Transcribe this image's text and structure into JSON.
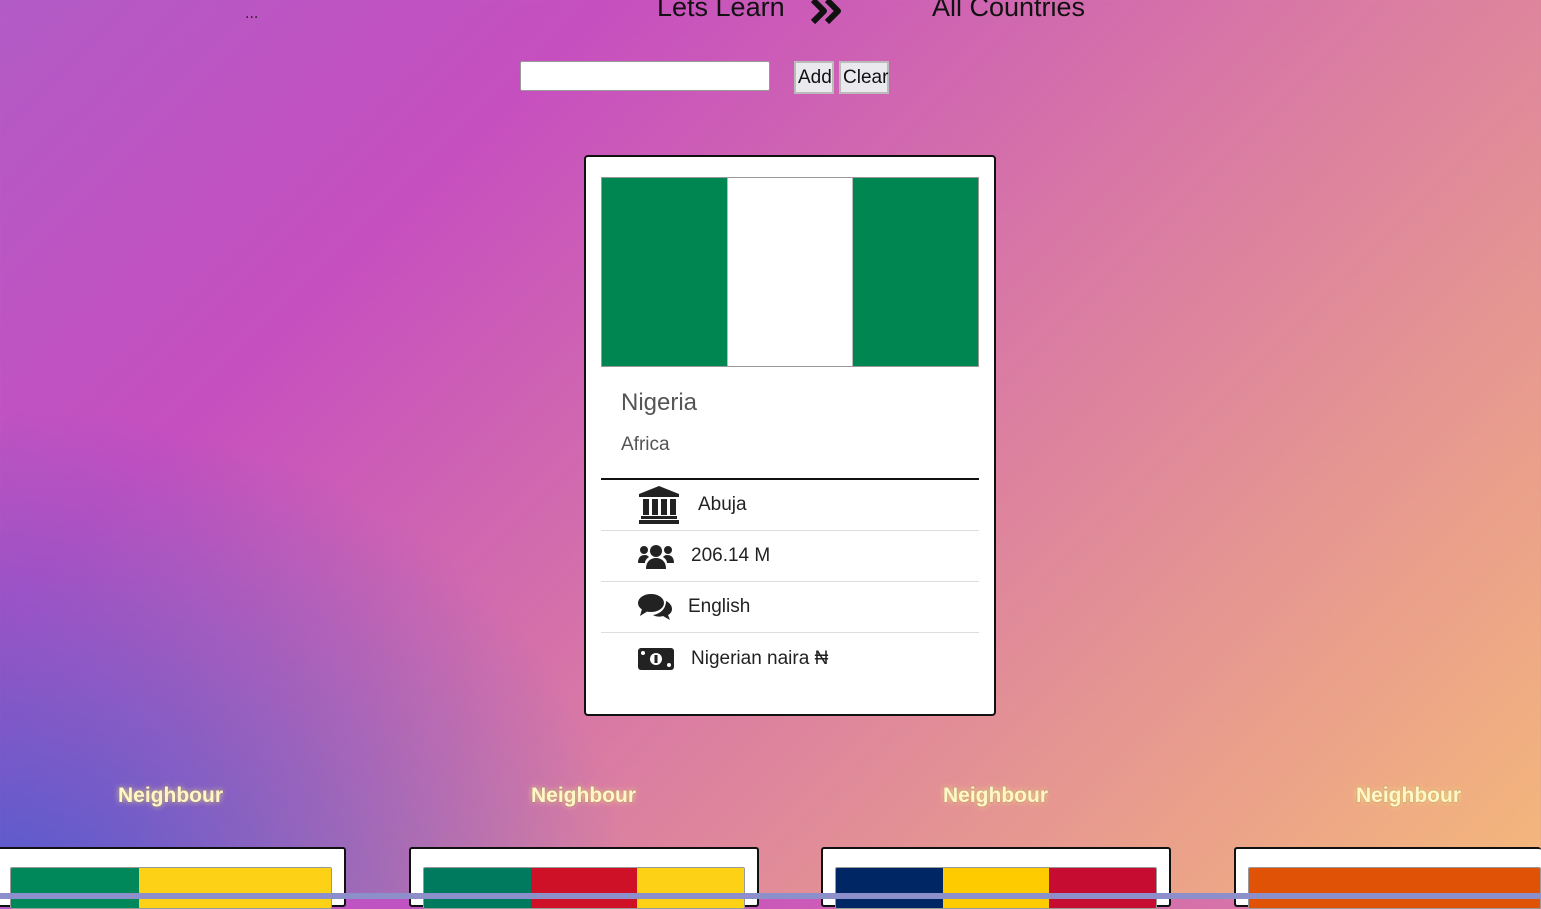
{
  "header": {
    "dots": "...",
    "nav_learn": "Lets Learn",
    "nav_all": "All Countries"
  },
  "search": {
    "value": "",
    "placeholder": ""
  },
  "buttons": {
    "add": "Add",
    "clear": "Clear"
  },
  "country": {
    "name": "Nigeria",
    "region": "Africa",
    "flag_colors": [
      "#008751",
      "#ffffff",
      "#008751"
    ],
    "capital": "Abuja",
    "population": "206.14 M",
    "language": "English",
    "currency": "Nigerian naira ₦",
    "icons": [
      "capital-building-icon",
      "population-users-icon",
      "language-comments-icon",
      "currency-money-icon"
    ]
  },
  "neighbours": [
    {
      "label": "Neighbour",
      "flag_colors": [
        "#00875a",
        "#fcd116",
        "#fcd116"
      ]
    },
    {
      "label": "Neighbour",
      "flag_colors": [
        "#007a5e",
        "#ce1126",
        "#fcd116"
      ]
    },
    {
      "label": "Neighbour",
      "flag_colors": [
        "#002664",
        "#fecb00",
        "#c60c30"
      ]
    },
    {
      "label": "Neighbour",
      "flag_colors": [
        "#e05206",
        "#e05206",
        "#e05206"
      ]
    }
  ]
}
